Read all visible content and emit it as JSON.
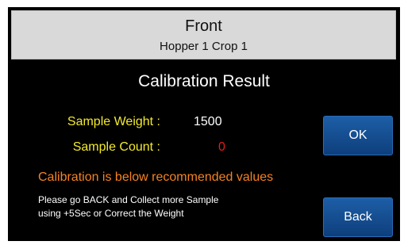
{
  "header": {
    "title": "Front",
    "subtitle": "Hopper 1 Crop 1"
  },
  "result": {
    "title": "Calibration Result",
    "sample_weight_label": "Sample Weight :",
    "sample_weight_value": "1500",
    "sample_count_label": "Sample Count :",
    "sample_count_value": "0",
    "warning": "Calibration is below recommended values",
    "help_line1": "Please go BACK and Collect more Sample",
    "help_line2": "using +5Sec or Correct the Weight"
  },
  "buttons": {
    "ok_label": "OK",
    "back_label": "Back"
  },
  "colors": {
    "screen_background": "#000000",
    "header_background": "#d9d9d9",
    "label_yellow": "#f2ea2a",
    "value_white": "#ffffff",
    "count_red": "#e51c1c",
    "warning_orange": "#f58220",
    "button_blue": "#1d5ea6"
  }
}
